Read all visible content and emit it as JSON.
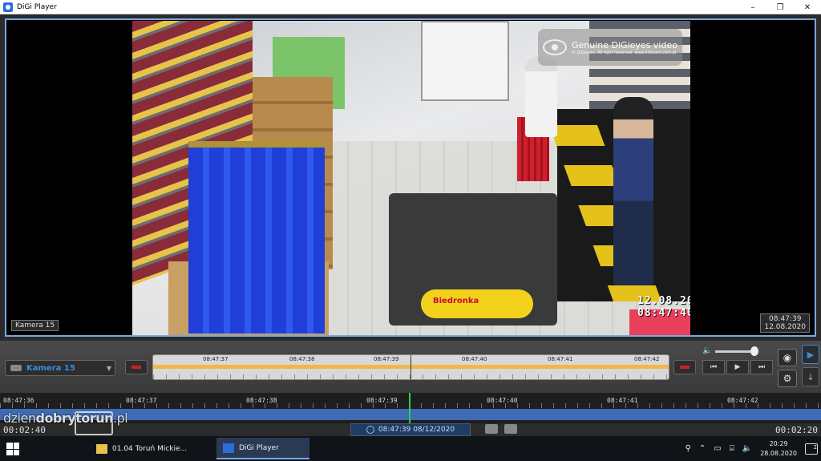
{
  "window": {
    "title": "DiGi Player",
    "minimize": "–",
    "maximize": "❐",
    "close": "✕"
  },
  "video": {
    "watermark_title": "Genuine DiGieyes video",
    "watermark_sub": "© DiGieyes. All right reserved. www.infocam.com.pl",
    "osd_datetime": "12.08.2020 08:47:40",
    "store_label": "Biedronka",
    "camera_label": "Kamera 15",
    "timestamp_time": "08:47:39",
    "timestamp_date": "12.08.2020"
  },
  "controls": {
    "camera_select": "Kamera 15",
    "timeline_labels": [
      "08:47:37",
      "08:47:38",
      "08:47:39",
      "08:47:40",
      "08:47:41",
      "08:47:42"
    ],
    "transport": [
      "⏮",
      "▶",
      "⏭"
    ]
  },
  "timeline": {
    "labels": [
      "08:47:36",
      "08:47:37",
      "08:47:38",
      "08:47:39",
      "08:47:40",
      "08:47:41",
      "08:47:42"
    ]
  },
  "status": {
    "elapsed": "00:02:40",
    "remaining": "00:02:20",
    "current": "08:47:39 08/12/2020"
  },
  "taskbar": {
    "items": [
      "01.04 Toruń Mickie...",
      "DiGi Player"
    ],
    "time": "20:29",
    "date": "28.08.2020",
    "notifications": "2"
  },
  "overlay": {
    "site_prefix": "dzien",
    "site_bold1": "dobry",
    "site_bold2": "torun",
    "site_suffix": ".pl"
  },
  "colors": {
    "accent": "#3a8de0",
    "timeline_track": "#3e6bb3",
    "cursor": "#2bd14a"
  }
}
